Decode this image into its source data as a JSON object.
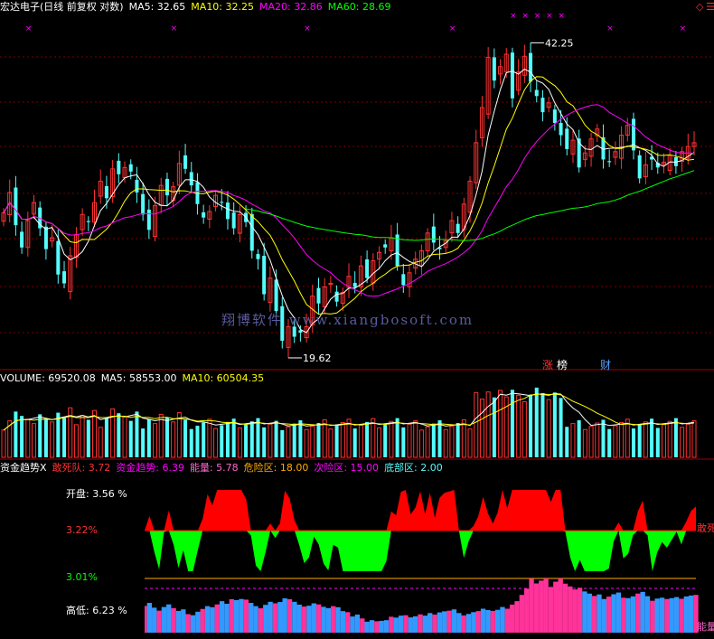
{
  "header_main": {
    "title": "宏达电子(日线 前复权 对数)",
    "ma5": "MA5: 32.65",
    "ma10": "MA10: 32.25",
    "ma20": "MA20: 32.86",
    "ma60": "MA60: 28.69"
  },
  "annotations": {
    "high": "42.25",
    "low": "19.62",
    "tag_zhang": "涨",
    "tag_bang": "榜",
    "tag_cai": "财"
  },
  "watermark": "翔博软件 www.xiangbosoft.com",
  "header_volume": {
    "volume": "VOLUME: 69520.08",
    "ma5": "MA5: 58553.00",
    "ma10": "MA10: 60504.35"
  },
  "header_fund": {
    "name": "资金趋势X",
    "gansidui": "敢死队: 3.72",
    "zijin": "资金趋势: 6.39",
    "nengliang": "能量: 5.78",
    "weixian": "危险区: 18.00",
    "cixian": "次险区: 15.00",
    "dibu": "底部区: 2.00"
  },
  "left_panel": {
    "open_label": "开盘: 3.56 %",
    "upper_pct": "3.22%",
    "lower_pct": "3.01%",
    "highlow_label": "高低: 6.23 %"
  },
  "right_labels": {
    "gansi": "敢死",
    "neng": "能量"
  },
  "colors": {
    "up": "#ff3232",
    "down": "#54fcfc",
    "ma5": "#ffffff",
    "ma10": "#ffff00",
    "ma20": "#ff00ff",
    "ma60": "#00ff00",
    "fund_up": "#ff0000",
    "fund_down": "#00ff00",
    "energy_red": "#ff3399",
    "energy_blue": "#3399ff"
  },
  "chart_data": {
    "type": "candlestick",
    "close": [
      27.2,
      28.6,
      26.4,
      25.0,
      26.7,
      27.9,
      26.2,
      24.9,
      25.6,
      23.4,
      22.9,
      24.5,
      25.8,
      27.1,
      26.6,
      27.9,
      29.4,
      28.2,
      30.3,
      29.9,
      30.4,
      30.1,
      28.6,
      27.1,
      26.1,
      27.7,
      29.1,
      28.4,
      29.0,
      30.7,
      30.3,
      29.1,
      27.8,
      26.9,
      27.3,
      28.4,
      27.9,
      26.8,
      26.2,
      27.1,
      26.6,
      24.8,
      24.3,
      22.3,
      23.2,
      21.4,
      19.9,
      20.6,
      20.1,
      20.3,
      20.6,
      22.2,
      21.8,
      22.7,
      22.9,
      21.9,
      22.4,
      23.3,
      22.7,
      23.9,
      23.2,
      24.2,
      24.7,
      25.0,
      25.6,
      23.9,
      22.8,
      23.5,
      24.3,
      24.8,
      25.9,
      25.3,
      24.9,
      25.4,
      26.7,
      25.9,
      27.8,
      29.4,
      32.3,
      35.2,
      39.8,
      37.6,
      38.9,
      40.1,
      36.0,
      38.4,
      39.9,
      37.5,
      36.2,
      34.8,
      35.6,
      33.9,
      32.9,
      31.8,
      32.5,
      30.4,
      31.5,
      32.6,
      33.4,
      31.0,
      30.8,
      31.6,
      32.9,
      33.7,
      31.7,
      29.6,
      30.6,
      31.0,
      30.4,
      30.8,
      31.3,
      30.5,
      31.6,
      32.0,
      32.3
    ]
  }
}
